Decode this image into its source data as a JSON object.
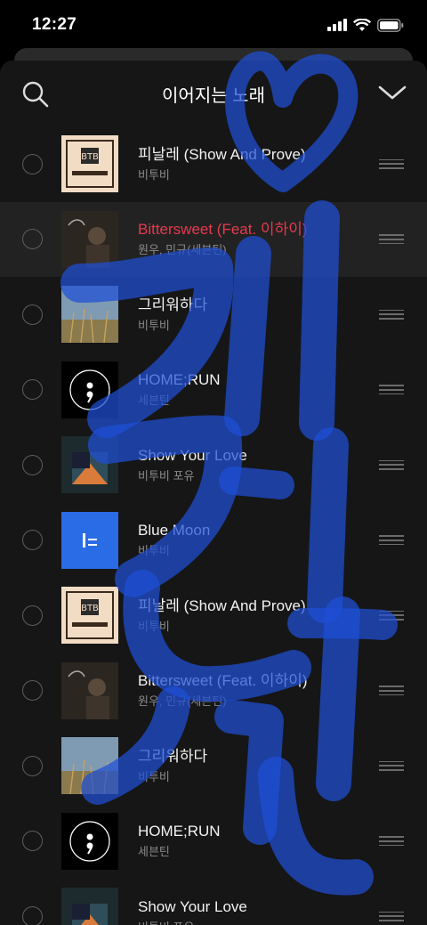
{
  "status_bar": {
    "time": "12:27",
    "signal_icon": "signal-bars-icon",
    "wifi_icon": "wifi-icon",
    "battery_icon": "battery-icon"
  },
  "header": {
    "title": "이어지는 노래",
    "search_icon": "search-icon",
    "collapse_icon": "chevron-down-icon"
  },
  "colors": {
    "background": "#161616",
    "playing_highlight": "#e8394e",
    "playing_row": "#222222",
    "overlay_stroke": "#1f4fd6"
  },
  "tracks": [
    {
      "title": "피날레 (Show And Prove)",
      "artist": "비투비",
      "cover": "btob-finale",
      "playing": false
    },
    {
      "title": "Bittersweet (Feat. 이하이)",
      "artist": "원우, 민규(세븐틴)",
      "cover": "bittersweet",
      "playing": true
    },
    {
      "title": "그리워하다",
      "artist": "비투비",
      "cover": "reeds",
      "playing": false
    },
    {
      "title": "HOME;RUN",
      "artist": "세븐틴",
      "cover": "semicolon",
      "playing": false
    },
    {
      "title": "Show Your Love",
      "artist": "비투비 포유",
      "cover": "inside",
      "playing": false
    },
    {
      "title": "Blue Moon",
      "artist": "비투비",
      "cover": "blue-moon",
      "playing": false
    },
    {
      "title": "피날레 (Show And Prove)",
      "artist": "비투비",
      "cover": "btob-finale",
      "playing": false
    },
    {
      "title": "Bittersweet (Feat. 이하이)",
      "artist": "원우, 민규(세븐틴)",
      "cover": "bittersweet",
      "playing": false
    },
    {
      "title": "그리워하다",
      "artist": "비투비",
      "cover": "reeds",
      "playing": false
    },
    {
      "title": "HOME;RUN",
      "artist": "세븐틴",
      "cover": "semicolon",
      "playing": false
    },
    {
      "title": "Show Your Love",
      "artist": "비투비 포유",
      "cover": "inside",
      "playing": false
    }
  ]
}
